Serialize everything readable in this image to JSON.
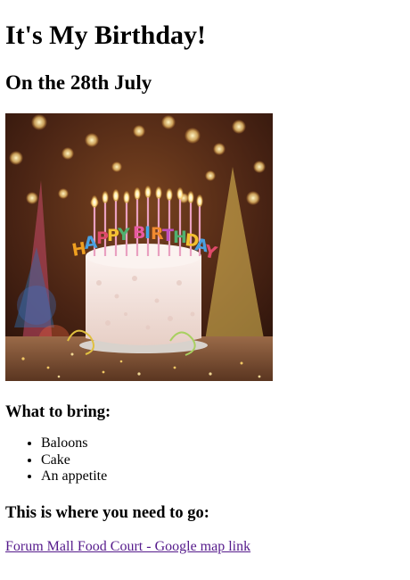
{
  "page": {
    "title": "It's My Birthday!",
    "subtitle": "On the 28th July"
  },
  "photo": {
    "candle_lettering": "HAPPY BIRTHDAY",
    "colors": {
      "bg_dark": "#3a1d12",
      "bg_warm": "#6b3b1e",
      "cake_cream": "#f2e4e0",
      "table": "#8a5a3a"
    }
  },
  "bring": {
    "heading": "What to bring:",
    "items": [
      "Baloons",
      "Cake",
      "An appetite"
    ]
  },
  "go": {
    "heading": "This is where you need to go:",
    "link_text": "Forum Mall Food Court - Google map link"
  },
  "colors": {
    "link_visited": "#551a8b",
    "text": "#000000",
    "background": "#ffffff"
  }
}
